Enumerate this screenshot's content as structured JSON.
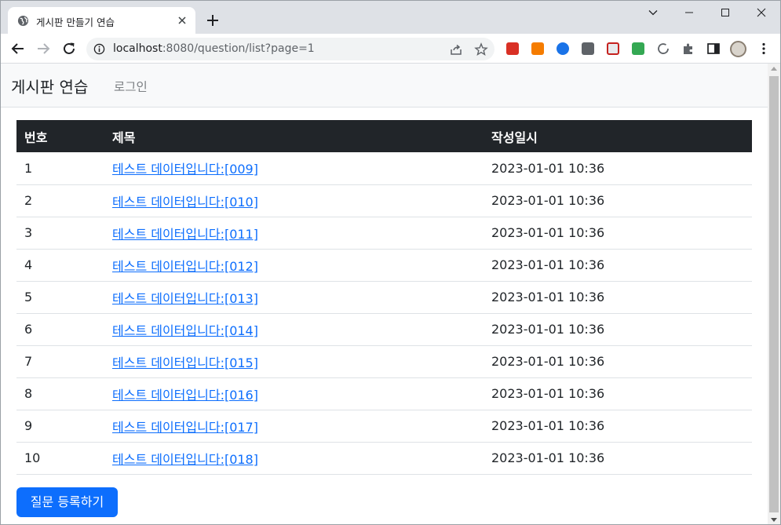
{
  "browser": {
    "tab": {
      "title": "게시판 만들기 연습"
    },
    "address_bar": {
      "host": "localhost",
      "path": ":8080/question/list?page=1"
    }
  },
  "navbar": {
    "brand": "게시판 연습",
    "login": "로그인"
  },
  "table": {
    "headers": {
      "number": "번호",
      "title": "제목",
      "created": "작성일시"
    },
    "rows": [
      {
        "number": "1",
        "title": "테스트 데이터입니다:[009]",
        "created": "2023-01-01 10:36"
      },
      {
        "number": "2",
        "title": "테스트 데이터입니다:[010]",
        "created": "2023-01-01 10:36"
      },
      {
        "number": "3",
        "title": "테스트 데이터입니다:[011]",
        "created": "2023-01-01 10:36"
      },
      {
        "number": "4",
        "title": "테스트 데이터입니다:[012]",
        "created": "2023-01-01 10:36"
      },
      {
        "number": "5",
        "title": "테스트 데이터입니다:[013]",
        "created": "2023-01-01 10:36"
      },
      {
        "number": "6",
        "title": "테스트 데이터입니다:[014]",
        "created": "2023-01-01 10:36"
      },
      {
        "number": "7",
        "title": "테스트 데이터입니다:[015]",
        "created": "2023-01-01 10:36"
      },
      {
        "number": "8",
        "title": "테스트 데이터입니다:[016]",
        "created": "2023-01-01 10:36"
      },
      {
        "number": "9",
        "title": "테스트 데이터입니다:[017]",
        "created": "2023-01-01 10:36"
      },
      {
        "number": "10",
        "title": "테스트 데이터입니다:[018]",
        "created": "2023-01-01 10:36"
      }
    ]
  },
  "actions": {
    "register_question": "질문 등록하기"
  },
  "colors": {
    "primary": "#0d6efd",
    "table_header": "#212529",
    "navbar_bg": "#f8f9fa"
  }
}
